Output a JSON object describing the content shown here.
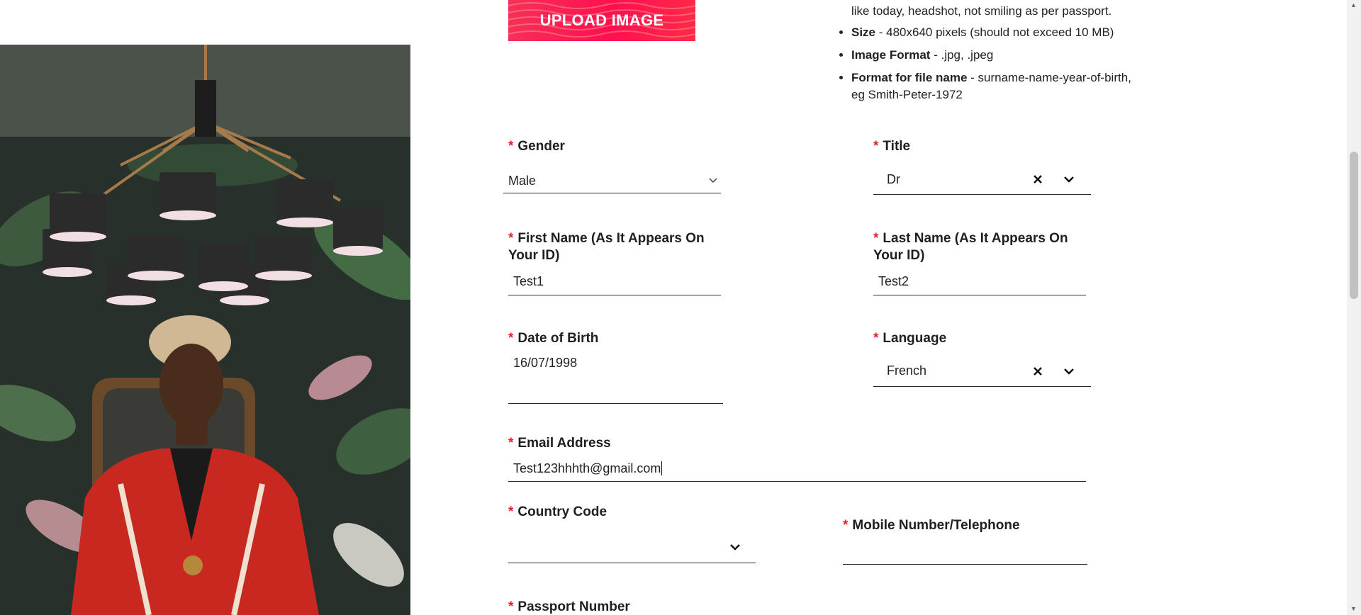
{
  "upload": {
    "label": "UPLOAD IMAGE"
  },
  "guidelines": {
    "continuation": "like today, headshot, not smiling as per passport.",
    "items": [
      {
        "term": "Size",
        "text": " - 480x640 pixels (should not exceed 10 MB)"
      },
      {
        "term": "Image Format",
        "text": " - .jpg, .jpeg"
      },
      {
        "term": "Format for file name",
        "text": " - surname-name-year-of-birth, eg Smith-Peter-1972"
      }
    ]
  },
  "required_mark": "*",
  "form": {
    "gender": {
      "label": "Gender",
      "value": "Male"
    },
    "title": {
      "label": "Title",
      "value": "Dr"
    },
    "first_name": {
      "label": "First Name (As It Appears On Your ID)",
      "value": "Test1"
    },
    "last_name": {
      "label": "Last Name (As It Appears On Your ID)",
      "value": "Test2"
    },
    "dob": {
      "label": "Date of Birth",
      "value": "16/07/1998"
    },
    "language": {
      "label": "Language",
      "value": "French"
    },
    "email": {
      "label": "Email Address",
      "value": "Test123hhhth@gmail.com"
    },
    "country_code": {
      "label": "Country Code",
      "value": ""
    },
    "mobile": {
      "label": "Mobile Number/Telephone",
      "value": ""
    },
    "passport": {
      "label": "Passport Number"
    }
  },
  "colors": {
    "accent": "#ff0f50",
    "required": "#e5202e"
  }
}
